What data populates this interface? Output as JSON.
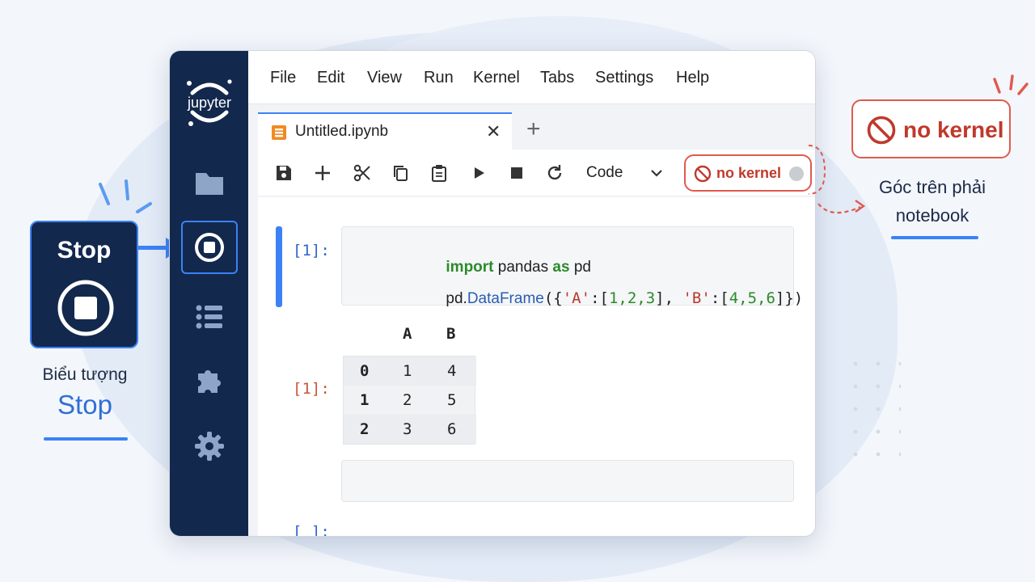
{
  "menu": [
    "File",
    "Edit",
    "View",
    "Run",
    "Kernel",
    "Tabs",
    "Settings",
    "Help"
  ],
  "logo_text": "jupyter",
  "tab": {
    "label": "Untitled.ipynb",
    "close": "✕",
    "add": "+"
  },
  "toolbar": {
    "cell_type": "Code"
  },
  "kernel_status": "no kernel",
  "cells": {
    "in1_prompt": "[1]:",
    "code_line1": {
      "import": "import",
      "module": " pandas ",
      "as": "as",
      "alias": " pd"
    },
    "code_line2": {
      "prefix": "pd.",
      "func": "DataFrame",
      "p1": "({",
      "s1": "'A'",
      "c1": ":[",
      "n1": "1,2,3",
      "c2": "], ",
      "s2": "'B'",
      "c3": ":[",
      "n2": "4,5,6",
      "c4": "]})"
    },
    "out1_prompt": "[1]:",
    "dataframe": {
      "columns": [
        "A",
        "B"
      ],
      "rows": [
        {
          "index": "0",
          "A": "1",
          "B": "4"
        },
        {
          "index": "1",
          "A": "2",
          "B": "5"
        },
        {
          "index": "2",
          "A": "3",
          "B": "6"
        }
      ]
    },
    "empty_prompt": "[ ]:"
  },
  "callouts": {
    "stop_title": "Stop",
    "stop_caption_1": "Biểu tượng",
    "stop_caption_2": "Stop",
    "kernel_card": "no kernel",
    "kernel_caption_1": "Góc trên phải",
    "kernel_caption_2": "notebook"
  },
  "colors": {
    "sidebar": "#13284d",
    "accent": "#3b82f6",
    "alert": "#e05a4f"
  }
}
